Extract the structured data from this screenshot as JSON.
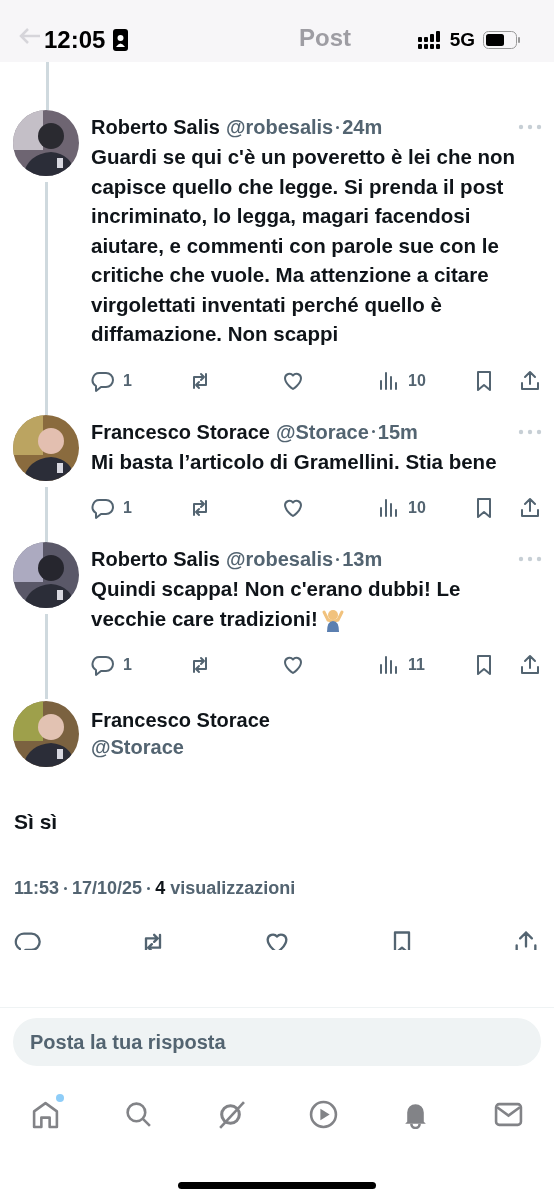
{
  "status_bar": {
    "time": "12:05",
    "network": "5G"
  },
  "header": {
    "title": "Post"
  },
  "replies": [
    {
      "name": "Roberto Salis",
      "handle": "@robesalis",
      "time": "24m",
      "text": "Guardi se qui c'è un poveretto è lei che non capisce quello che legge. Si prenda il post incriminato, lo legga, magari facendosi aiutare, e commenti con parole sue con le critiche che vuole. Ma attenzione a citare virgolettati inventati perché quello è diffamazione. Non scappi",
      "emoji": false,
      "replies": "1",
      "views": "10"
    },
    {
      "name": "Francesco Storace",
      "handle": "@Storace",
      "time": "15m",
      "text": "Mi basta l’articolo di Gramellini. Stia bene",
      "emoji": false,
      "replies": "1",
      "views": "10"
    },
    {
      "name": "Roberto Salis",
      "handle": "@robesalis",
      "time": "13m",
      "text": "Quindi scappa! Non c'erano dubbi! Le vecchie care tradizioni!",
      "emoji": true,
      "replies": "1",
      "views": "11"
    }
  ],
  "main_post": {
    "name": "Francesco Storace",
    "handle": "@Storace",
    "text": "Sì sì",
    "time": "11:53",
    "date": "17/10/25",
    "views_count": "4",
    "views_label": "visualizzazioni"
  },
  "reply_field": {
    "placeholder": "Posta la tua risposta"
  },
  "nav": [
    {
      "kind": "home",
      "unread_dot": true
    },
    {
      "kind": "search",
      "unread_dot": false
    },
    {
      "kind": "grok",
      "unread_dot": false
    },
    {
      "kind": "video",
      "unread_dot": false
    },
    {
      "kind": "bell",
      "unread_dot": false
    },
    {
      "kind": "mail",
      "unread_dot": false
    }
  ]
}
